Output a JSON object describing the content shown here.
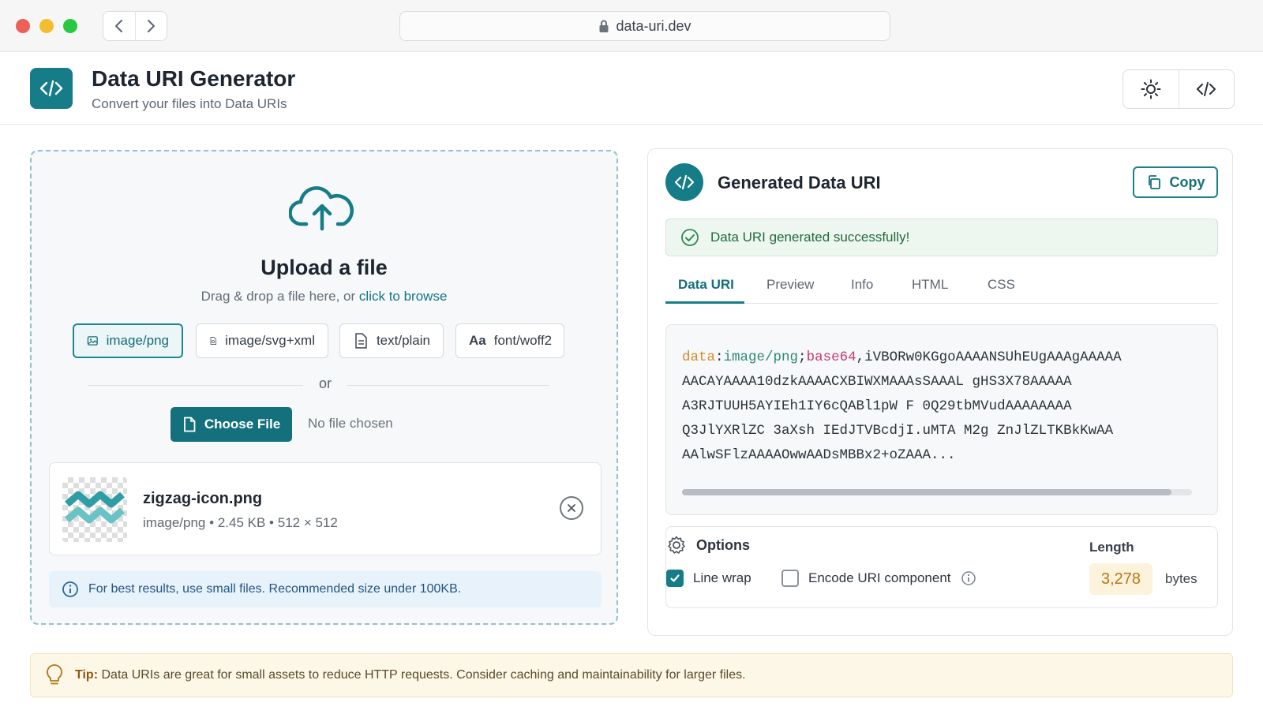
{
  "browser": {
    "url": "data-uri.dev"
  },
  "header": {
    "title": "Data URI Generator",
    "subtitle": "Convert your files into Data URIs"
  },
  "upload": {
    "title": "Upload a file",
    "hint_prefix": "Drag & drop a file here, or",
    "hint_link": "click to browse",
    "chips": [
      {
        "label": "image/png",
        "icon": "image-icon",
        "active": true
      },
      {
        "label": "image/svg+xml",
        "icon": "file-image-icon",
        "active": false
      },
      {
        "label": "text/plain",
        "icon": "file-text-icon",
        "active": false
      },
      {
        "label": "font/woff2",
        "icon": "font-icon",
        "glyph": "Aa",
        "active": false
      }
    ],
    "or_text": "or",
    "choose_label": "Choose File",
    "no_file_text": "No file chosen",
    "file": {
      "name": "zigzag-icon.png",
      "type": "image/png",
      "size": "2.45 KB",
      "dimensions": "512 × 512"
    },
    "info_text": "For best results, use small files. Recommended size under 100KB."
  },
  "output": {
    "title": "Generated Data URI",
    "copy_label": "Copy",
    "success_text": "Data URI generated successfully!",
    "tabs": [
      "Data URI",
      "Preview",
      "Info",
      "HTML",
      "CSS"
    ],
    "active_tab": "Data URI",
    "code": {
      "scheme": "data",
      "mime": "image/png",
      "encoding": "base64",
      "first_line_rest": "iVBORw0KGgoAAAANSUhEUgAAAgAAAAA",
      "lines": [
        "AACAYAAAA10dzkAAAACXBIWXMAAAsSAAAL gHS3X78AAAAA",
        "A3RJTUUH5AYIEh1IY6cQABl1pW F 0Q29tbMVudAAAAAAAA",
        "Q3JlYXRlZC 3aXsh IEdJTVBcdjI.uMTA M2g ZnJlZLTKBkKwAA",
        "AAlwSFlzAAAAOwwAADsMBBx2+oZAAA..."
      ]
    },
    "options": {
      "title": "Options",
      "line_wrap_label": "Line wrap",
      "line_wrap_checked": true,
      "encode_label": "Encode URI component",
      "encode_checked": false,
      "length_label": "Length",
      "length_value": "3,278",
      "length_unit": "bytes"
    }
  },
  "tip": {
    "label": "Tip:",
    "text": "Data URIs are great for small assets to reduce HTTP requests. Consider caching and maintainability for larger files."
  },
  "colors": {
    "accent": "#157c88",
    "success": "#226a3d",
    "length_value": "#b87516"
  }
}
